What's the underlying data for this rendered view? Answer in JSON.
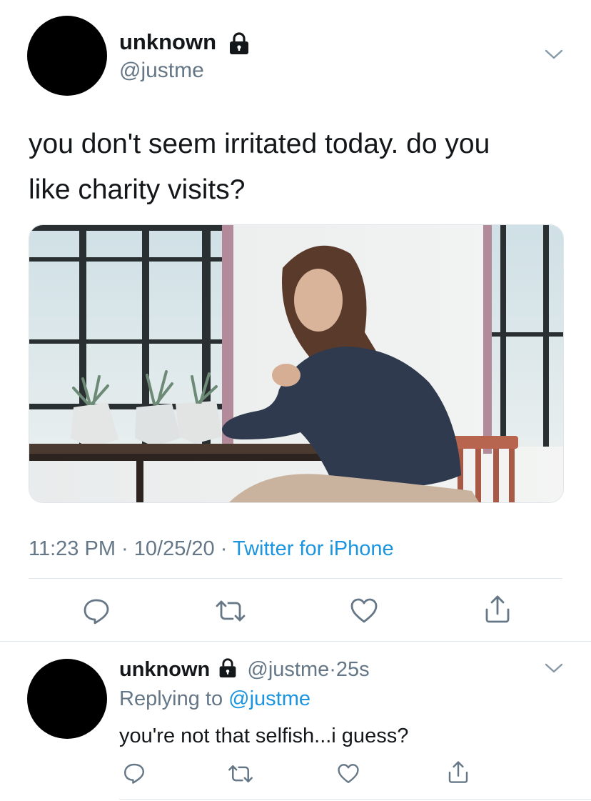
{
  "main_tweet": {
    "display_name": "unknown",
    "handle": "@justme",
    "text_line1": "you don't seem irritated today. do you",
    "text_line2": "like charity visits?",
    "time": "11:23 PM",
    "date": "10/25/20",
    "source": "Twitter for iPhone",
    "sep": "·"
  },
  "reply_tweet": {
    "display_name": "unknown",
    "handle": "@justme",
    "age": "25s",
    "sep": "·",
    "replying_prefix": "Replying to",
    "replying_to": "@justme",
    "text": "you're not that selfish...i guess?"
  },
  "icons": [
    "lock-icon",
    "chevron-down-icon",
    "reply-icon",
    "retweet-icon",
    "like-icon",
    "share-icon"
  ],
  "colors": {
    "link": "#1b95e0",
    "muted": "#657786",
    "text": "#14171a",
    "icon": "#657786",
    "divider": "#e1e8ed"
  }
}
